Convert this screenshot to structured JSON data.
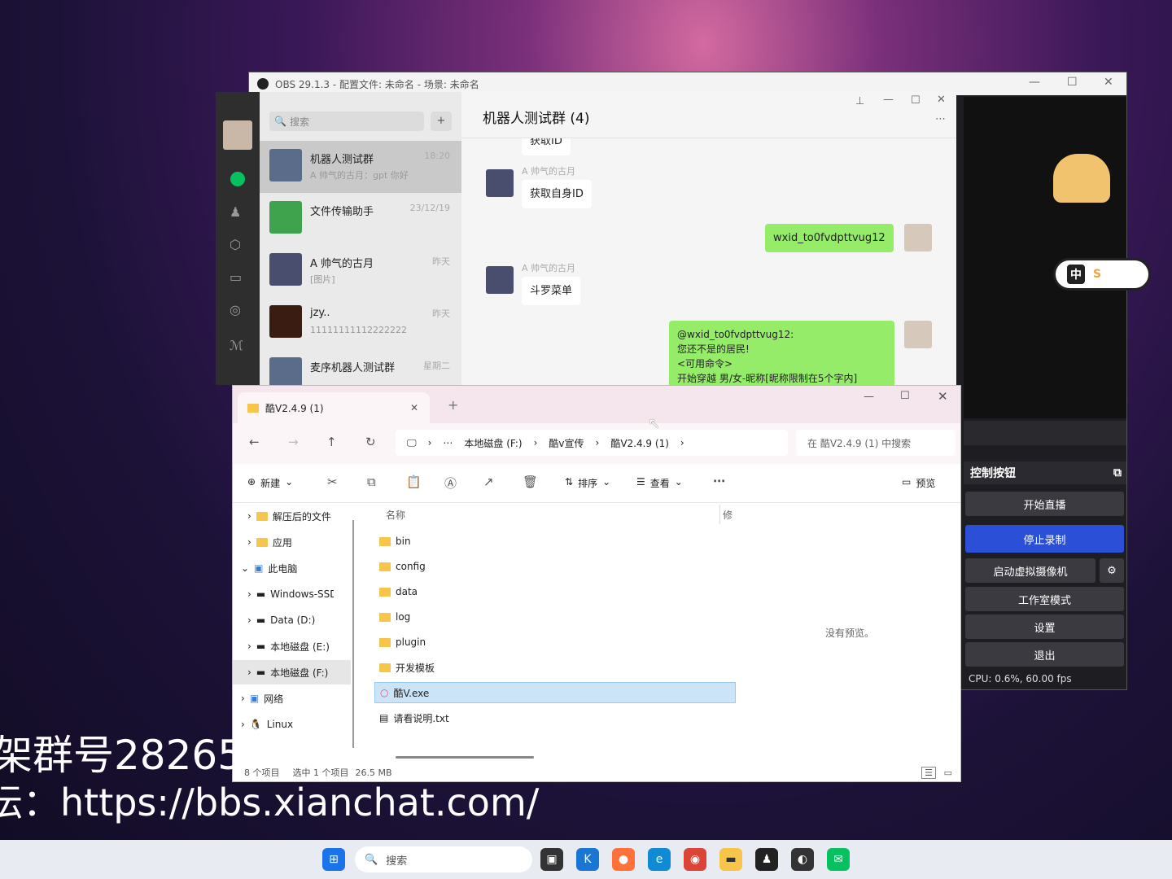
{
  "obs": {
    "title": "OBS 29.1.3 - 配置文件: 未命名 - 场景: 未命名",
    "controls_title": "控制按钮",
    "buttons": [
      "开始直播",
      "停止录制",
      "启动虚拟摄像机",
      "工作室模式",
      "设置",
      "退出"
    ],
    "status": "CPU: 0.6%, 60.00 fps",
    "sticker_keys": [
      "中",
      "S"
    ]
  },
  "wechat": {
    "search_placeholder": "搜索",
    "group_title": "机器人测试群 (4)",
    "chats": [
      {
        "name": "机器人测试群",
        "preview": "A 帅气的古月：gpt 你好",
        "time": "18:20"
      },
      {
        "name": "文件传输助手",
        "preview": "",
        "time": "23/12/19"
      },
      {
        "name": "A 帅气的古月",
        "preview": "[图片]",
        "time": "昨天"
      },
      {
        "name": "jzy..",
        "preview": "11111111112222222",
        "time": "昨天"
      },
      {
        "name": "麦序机器人测试群",
        "preview": "",
        "time": "星期二"
      }
    ],
    "messages": {
      "cut_top": "获取ID",
      "sender1": "A 帅气的古月",
      "msg1": "获取自身ID",
      "reply1": "wxid_to0fvdpttvug12",
      "sender2": "A 帅气的古月",
      "msg2": "斗罗菜单",
      "reply2": [
        "@wxid_to0fvdpttvug12:",
        "您还不是的居民!",
        "<可用命令>",
        "开始穿越 男/女-昵称[昵称限制在5个字内]"
      ]
    }
  },
  "explorer": {
    "tab": "酷V2.4.9 (1)",
    "breadcrumb": [
      "本地磁盘 (F:)",
      "酷v宣传",
      "酷V2.4.9 (1)"
    ],
    "search_placeholder": "在 酷V2.4.9 (1) 中搜索",
    "toolbar": {
      "new": "新建",
      "sort": "排序",
      "view": "查看",
      "preview": "预览"
    },
    "tree": [
      "解压后的文件",
      "应用",
      "此电脑",
      "Windows-SSD",
      "Data (D:)",
      "本地磁盘 (E:)",
      "本地磁盘 (F:)",
      "网络",
      "Linux"
    ],
    "col_name": "名称",
    "col_mod": "修",
    "files": [
      "bin",
      "config",
      "data",
      "log",
      "plugin",
      "开发模板",
      "酷V.exe",
      "请看说明.txt"
    ],
    "no_preview": "没有预览。",
    "status": [
      "8 个项目",
      "选中 1 个项目",
      "26.5 MB"
    ]
  },
  "overlay": {
    "line1": "架群号28265",
    "line2": "坛：https://bbs.xianchat.com/"
  },
  "taskbar": {
    "search": "搜索"
  }
}
